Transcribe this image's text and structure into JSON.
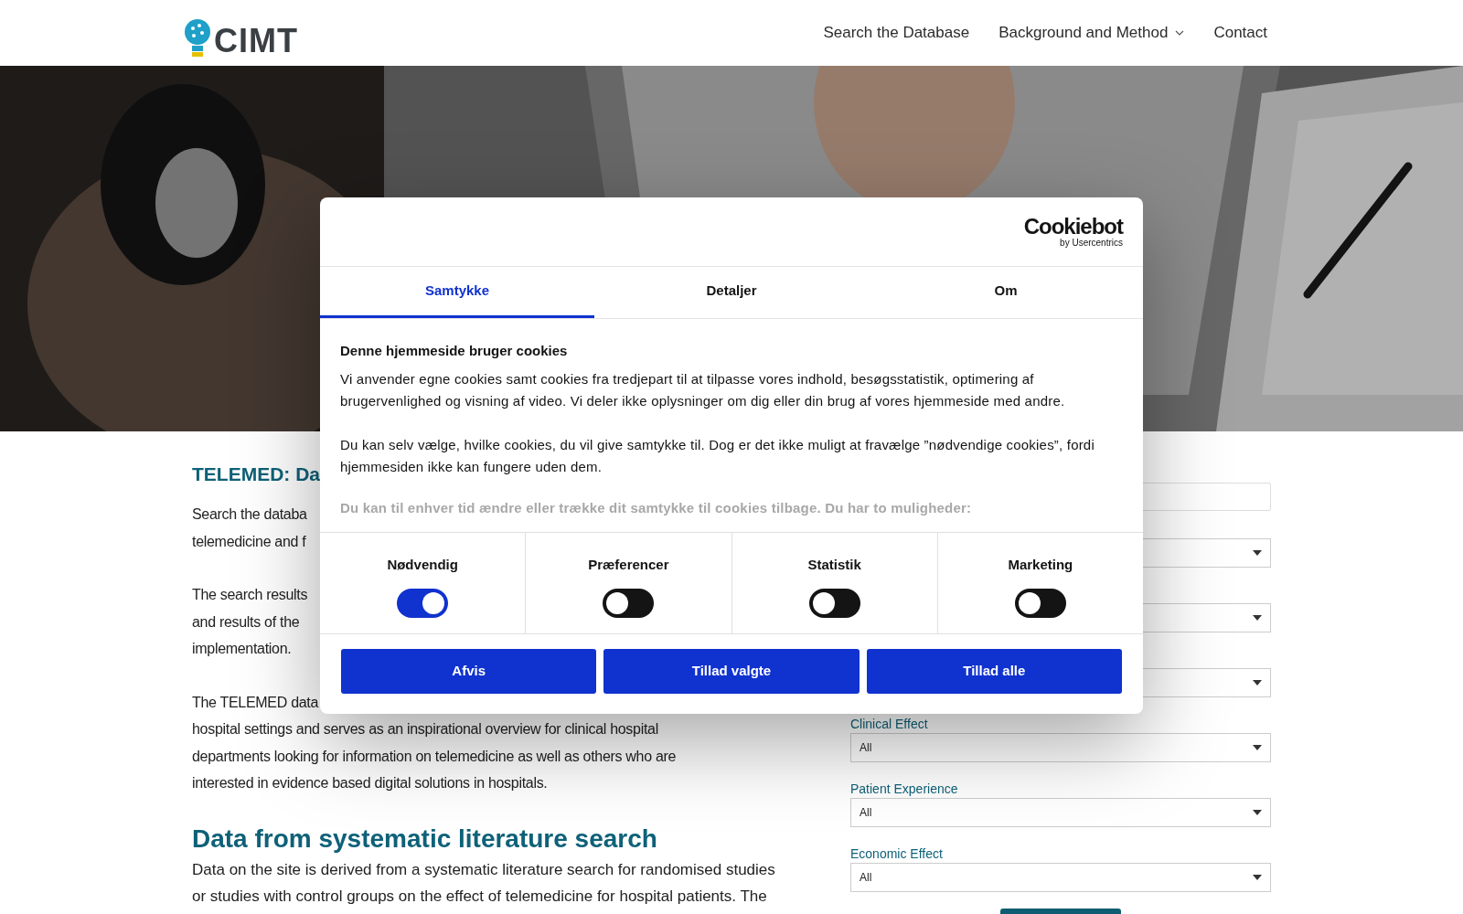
{
  "header": {
    "logo_text": "CIMT",
    "nav": [
      {
        "label": "Search the Database",
        "has_menu": false
      },
      {
        "label": "Background and Method",
        "has_menu": true
      },
      {
        "label": "Contact",
        "has_menu": false
      }
    ]
  },
  "intro": {
    "title": "TELEMED: Da",
    "paragraphs": [
      [
        "Search the databa",
        "telemedicine and f"
      ],
      [
        "The search results",
        "and results of the",
        "implementation."
      ],
      [
        "The TELEMED data",
        "hospital settings and serves as an inspirational overview for clinical hospital",
        "departments looking for information on telemedicine as well as others who are",
        "interested in evidence based digital solutions in hospitals."
      ]
    ]
  },
  "section": {
    "title": "Data from systematic literature search",
    "lines": [
      "Data on the site is derived from a systematic literature search for randomised studies",
      "or studies with control groups on the effect of telemedicine for hospital patients. The"
    ]
  },
  "filters": [
    {
      "kind": "text"
    },
    {
      "kind": "select"
    },
    {
      "kind": "select"
    },
    {
      "kind": "select"
    },
    {
      "kind": "select",
      "label": "Clinical Effect",
      "value": "All"
    },
    {
      "kind": "select",
      "label": "Patient Experience",
      "value": "All"
    },
    {
      "kind": "select",
      "label": "Economic Effect",
      "value": "All"
    }
  ],
  "consent": {
    "brand": "Cookiebot",
    "brand_sub": "by Usercentrics",
    "tabs": [
      {
        "label": "Samtykke",
        "selected": true
      },
      {
        "label": "Detaljer",
        "selected": false
      },
      {
        "label": "Om",
        "selected": false
      }
    ],
    "heading": "Denne hjemmeside bruger cookies",
    "paragraphs": [
      "Vi anvender egne cookies samt cookies fra tredjepart til at tilpasse vores indhold, besøgsstatistik, optimering af brugervenlighed og visning af video. Vi deler ikke oplysninger om dig eller din brug af vores hjemmeside med andre.",
      "Du kan selv vælge, hvilke cookies, du vil give samtykke til. Dog er det ikke muligt at fravælge ”nødvendige cookies”, fordi hjemmesiden ikke kan fungere uden dem."
    ],
    "faded_line": "Du kan til enhver tid ændre eller trække dit samtykke til cookies tilbage. Du har to muligheder:",
    "categories": [
      {
        "label": "Nødvendig",
        "on": true
      },
      {
        "label": "Præferencer",
        "on": false
      },
      {
        "label": "Statistik",
        "on": false
      },
      {
        "label": "Marketing",
        "on": false
      }
    ],
    "buttons": [
      "Afvis",
      "Tillad valgte",
      "Tillad alle"
    ]
  }
}
